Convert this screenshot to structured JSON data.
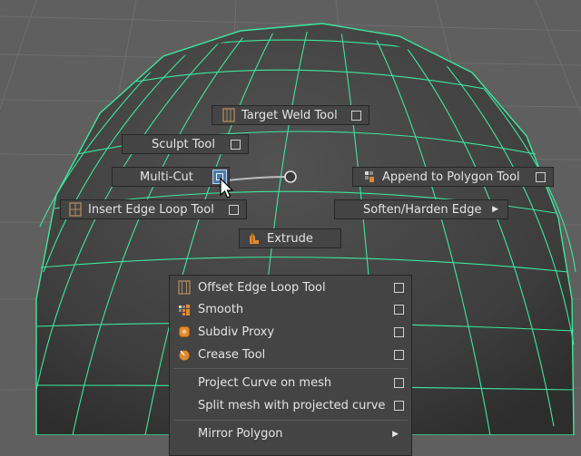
{
  "marking_menu": {
    "target_weld": {
      "label": "Target Weld Tool"
    },
    "sculpt": {
      "label": "Sculpt Tool"
    },
    "multicut": {
      "label": "Multi-Cut"
    },
    "append_poly": {
      "label": "Append to Polygon Tool"
    },
    "insert_edge_loop": {
      "label": "Insert Edge Loop Tool"
    },
    "soften_harden": {
      "label": "Soften/Harden Edge"
    },
    "extrude": {
      "label": "Extrude"
    }
  },
  "menu": {
    "items": [
      {
        "label": "Offset Edge Loop Tool",
        "icon": "offset-edge-loop-icon"
      },
      {
        "label": "Smooth",
        "icon": "smooth-icon"
      },
      {
        "label": "Subdiv Proxy",
        "icon": "subdiv-proxy-icon"
      },
      {
        "label": "Crease Tool",
        "icon": "crease-tool-icon"
      },
      {
        "label": "Project Curve on mesh",
        "icon": ""
      },
      {
        "label": "Split mesh with projected curve",
        "icon": ""
      },
      {
        "label": "Mirror Polygon",
        "icon": ""
      }
    ]
  },
  "colors": {
    "background": "#5f5f5f",
    "grid": "#6e6e6e",
    "sphere": "#404040",
    "wireframe": "#3ee6a0",
    "menu_bg": "#444444",
    "highlight": "#4d7aab"
  }
}
